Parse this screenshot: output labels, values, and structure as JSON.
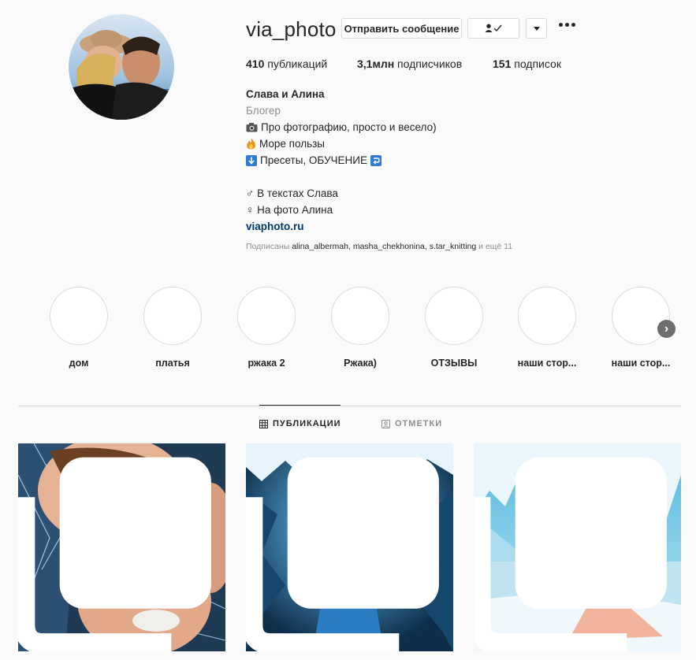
{
  "profile": {
    "username": "via_photo",
    "message_button": "Отправить сообщение",
    "stats": {
      "posts_count": "410",
      "posts_label": " публикаций",
      "followers_count": "3,1млн",
      "followers_label": " подписчиков",
      "following_count": "151",
      "following_label": " подписок"
    },
    "bio": {
      "name": "Слава и Алина",
      "category": "Блогер",
      "line1": "Про фотографию, просто и весело)",
      "line2": "Море пользы",
      "line3": "Пресеты, ОБУЧЕНИЕ",
      "line4": "В текстах Слава",
      "line5": "На фото Алина",
      "website": "viaphoto.ru"
    },
    "followed_by": {
      "prefix": "Подписаны ",
      "users": "alina_albermah, masha_chekhonina, s.tar_knitting",
      "suffix": " и ещё 11"
    }
  },
  "highlights": [
    {
      "label": "дом"
    },
    {
      "label": "платья"
    },
    {
      "label": "ржака 2"
    },
    {
      "label": "Ржака)"
    },
    {
      "label": "ОТЗЫВЫ"
    },
    {
      "label": "наши стор..."
    },
    {
      "label": "наши стор..."
    }
  ],
  "tabs": {
    "posts": "ПУБЛИКАЦИИ",
    "tagged": "ОТМЕТКИ"
  },
  "icons": {
    "more": "more-options-icon",
    "follow_status": "following-check-icon",
    "dropdown": "chevron-down-icon",
    "grid": "grid-icon",
    "tagged": "tagged-icon",
    "multi_post": "carousel-icon",
    "next": "chevron-right-icon"
  },
  "colors": {
    "link": "#00376b",
    "muted": "#8e8e8e",
    "text": "#262626",
    "border": "#dbdbdb"
  }
}
